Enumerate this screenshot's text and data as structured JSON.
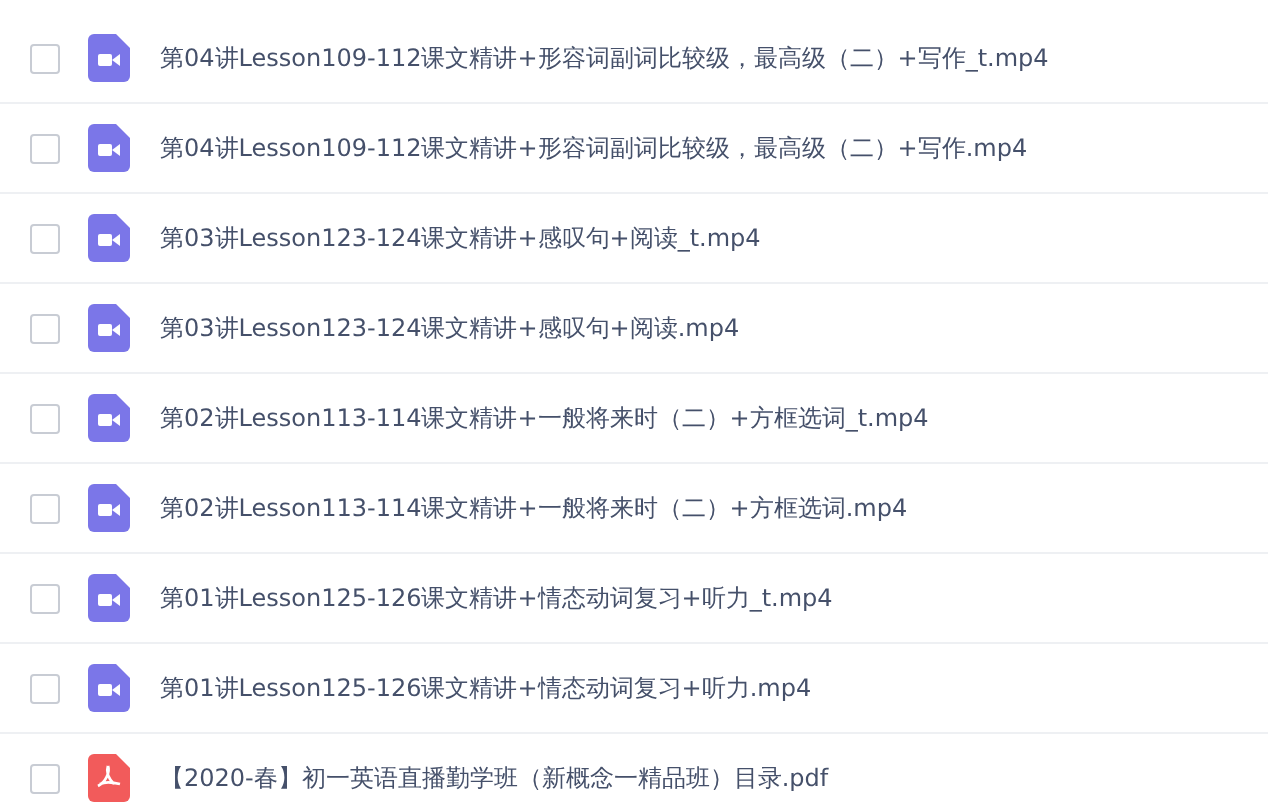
{
  "files": [
    {
      "kind": "video",
      "checked": false,
      "name": "第04讲Lesson109-112课文精讲+形容词副词比较级，最高级（二）+写作_t.mp4"
    },
    {
      "kind": "video",
      "checked": false,
      "name": "第04讲Lesson109-112课文精讲+形容词副词比较级，最高级（二）+写作.mp4"
    },
    {
      "kind": "video",
      "checked": false,
      "name": "第03讲Lesson123-124课文精讲+感叹句+阅读_t.mp4"
    },
    {
      "kind": "video",
      "checked": false,
      "name": "第03讲Lesson123-124课文精讲+感叹句+阅读.mp4"
    },
    {
      "kind": "video",
      "checked": false,
      "name": "第02讲Lesson113-114课文精讲+一般将来时（二）+方框选词_t.mp4"
    },
    {
      "kind": "video",
      "checked": false,
      "name": "第02讲Lesson113-114课文精讲+一般将来时（二）+方框选词.mp4"
    },
    {
      "kind": "video",
      "checked": false,
      "name": "第01讲Lesson125-126课文精讲+情态动词复习+听力_t.mp4"
    },
    {
      "kind": "video",
      "checked": false,
      "name": "第01讲Lesson125-126课文精讲+情态动词复习+听力.mp4"
    },
    {
      "kind": "pdf",
      "checked": false,
      "name": "【2020-春】初一英语直播勤学班（新概念一精品班）目录.pdf"
    }
  ]
}
